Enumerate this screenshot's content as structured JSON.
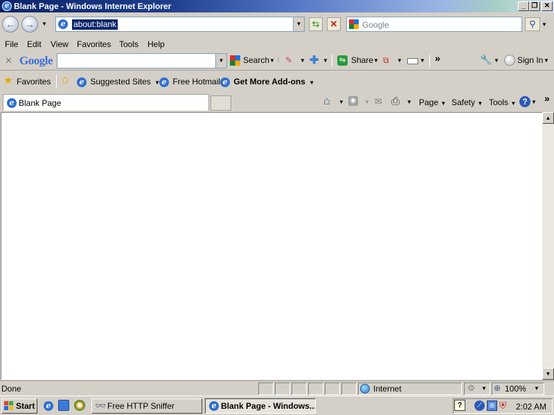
{
  "window": {
    "title": "Blank Page - Windows Internet Explorer"
  },
  "address": {
    "value": "about:blank"
  },
  "search": {
    "placeholder": "Google"
  },
  "menu": {
    "items": [
      "File",
      "Edit",
      "View",
      "Favorites",
      "Tools",
      "Help"
    ]
  },
  "google_toolbar": {
    "logo": "Google",
    "search_label": "Search",
    "share_label": "Share",
    "signin_label": "Sign In"
  },
  "favorites_bar": {
    "favorites_label": "Favorites",
    "links": [
      "Suggested Sites",
      "Free Hotmail",
      "Get More Add-ons"
    ]
  },
  "tab": {
    "label": "Blank Page"
  },
  "command_bar": {
    "page": "Page",
    "safety": "Safety",
    "tools": "Tools"
  },
  "status": {
    "text": "Done",
    "zone": "Internet",
    "zoom": "100%"
  },
  "taskbar": {
    "start_label": "Start",
    "buttons": [
      "Free HTTP Sniffer",
      "Blank Page - Windows..."
    ],
    "clock": "2:02 AM"
  },
  "colors": {
    "title_bar": "#0a246a",
    "selection": "#0a246a",
    "chrome": "#d4d0c8"
  }
}
